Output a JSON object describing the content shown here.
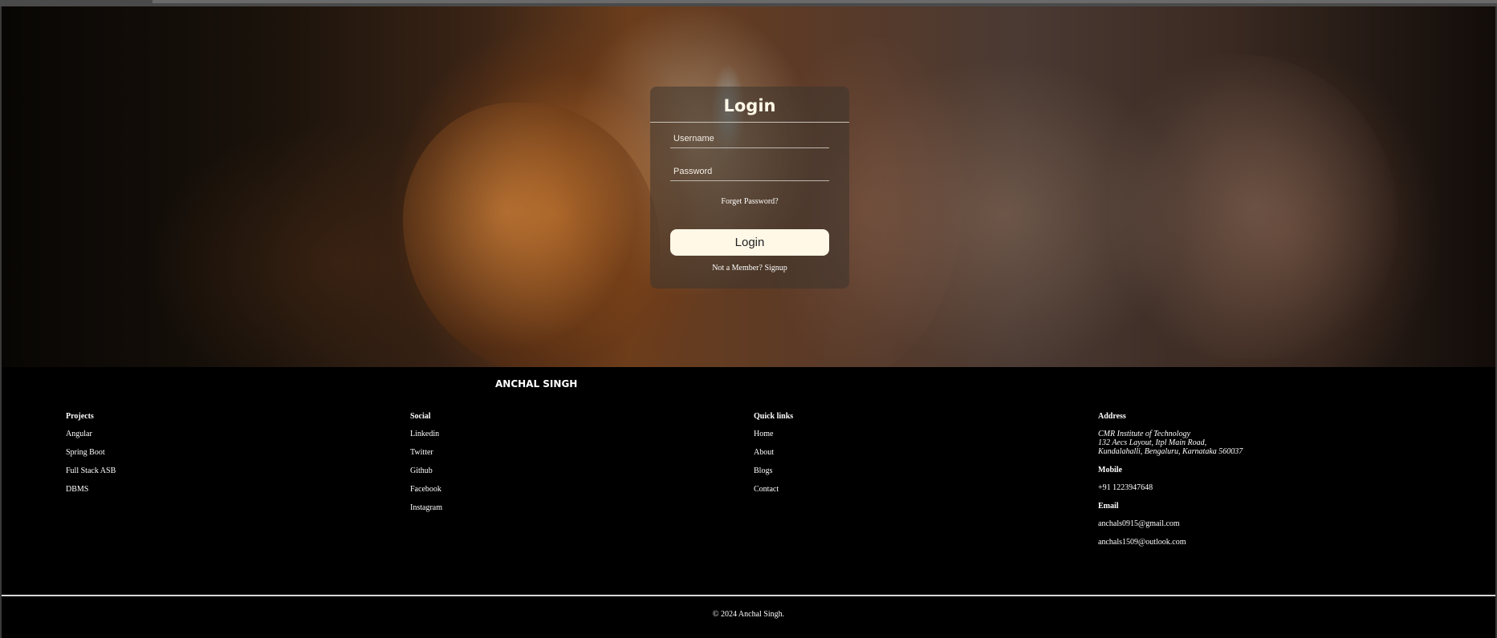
{
  "login": {
    "title": "Login",
    "username_placeholder": "Username",
    "password_placeholder": "Password",
    "forgot_label": "Forget Password?",
    "button_label": "Login",
    "signup_prefix": "Not a Member? ",
    "signup_link": "Signup"
  },
  "footer": {
    "brand": "ANCHAL SINGH",
    "projects": {
      "heading": "Projects",
      "items": [
        "Angular",
        "Spring Boot",
        "Full Stack ASB",
        "DBMS"
      ]
    },
    "social": {
      "heading": "Social",
      "items": [
        "Linkedin",
        "Twitter",
        "Github",
        "Facebook",
        "Instagram"
      ]
    },
    "quick_links": {
      "heading": "Quick links",
      "items": [
        "Home",
        "About",
        "Blogs",
        "Contact"
      ]
    },
    "address": {
      "heading": "Address",
      "lines": [
        "CMR Institute of Technology",
        "132 Aecs Layout, Itpl Main Road,",
        "Kundalahalli, Bengaluru, Karnataka 560037"
      ],
      "mobile_heading": "Mobile",
      "mobile": "+91 1223947648",
      "email_heading": "Email",
      "emails": [
        "anchals0915@gmail.com",
        "anchals1509@outlook.com"
      ]
    },
    "copyright": "© 2024 Anchal Singh."
  },
  "colors": {
    "background": "#000000",
    "button": "#fff8e7",
    "text": "#ffffff"
  }
}
